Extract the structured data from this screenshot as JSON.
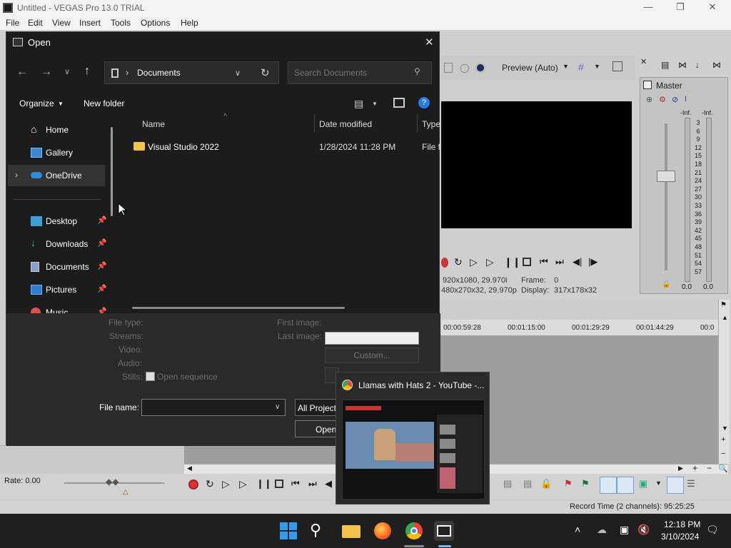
{
  "vegas": {
    "title": "Untitled - VEGAS Pro 13.0 TRIAL",
    "menu": [
      "File",
      "Edit",
      "View",
      "Insert",
      "Tools",
      "Options",
      "Help"
    ],
    "preview_mode": "Preview (Auto)",
    "preview_info": {
      "project_line": "920x1080, 29.970i",
      "preview_line": "480x270x32, 29.970p",
      "frame_label": "Frame:",
      "frame_value": "0",
      "display_label": "Display:",
      "display_value": "317x178x32"
    },
    "master": {
      "label": "Master",
      "inf_left": "-Inf.",
      "inf_right": "-Inf.",
      "scale": [
        "3",
        "6",
        "9",
        "12",
        "15",
        "18",
        "21",
        "24",
        "27",
        "30",
        "33",
        "36",
        "39",
        "42",
        "45",
        "48",
        "51",
        "54",
        "57"
      ],
      "readout_left": "0.0",
      "readout_right": "0.0"
    },
    "ruler": [
      "00:00:59:28",
      "00:01:15:00",
      "00:01:29:29",
      "00:01:44:29",
      "00:0"
    ],
    "rate": "Rate: 0.00",
    "status": "Record Time (2 channels): 95:25:25"
  },
  "dialog": {
    "title": "Open",
    "address": "Documents",
    "search_placeholder": "Search Documents",
    "organize": "Organize",
    "new_folder": "New folder",
    "nav": {
      "home": "Home",
      "gallery": "Gallery",
      "onedrive": "OneDrive",
      "desktop": "Desktop",
      "downloads": "Downloads",
      "documents": "Documents",
      "pictures": "Pictures",
      "music": "Music"
    },
    "columns": {
      "name": "Name",
      "date": "Date modified",
      "type": "Type"
    },
    "files": [
      {
        "name": "Visual Studio 2022",
        "date": "1/28/2024 11:28 PM",
        "type": "File fo"
      }
    ],
    "props": {
      "file_type": "File type:",
      "streams": "Streams:",
      "video": "Video:",
      "audio": "Audio:",
      "stills": "Stills:",
      "first_image": "First image:",
      "last_image": "Last image:",
      "custom": "Custom...",
      "open_sequence": "Open sequence"
    },
    "file_name_label": "File name:",
    "file_name_value": "",
    "filter": "All Project",
    "open_button": "Open"
  },
  "chrome_preview": {
    "title": "Llamas with Hats 2 - YouTube -..."
  },
  "taskbar": {
    "time": "12:18 PM",
    "date": "3/10/2024"
  }
}
